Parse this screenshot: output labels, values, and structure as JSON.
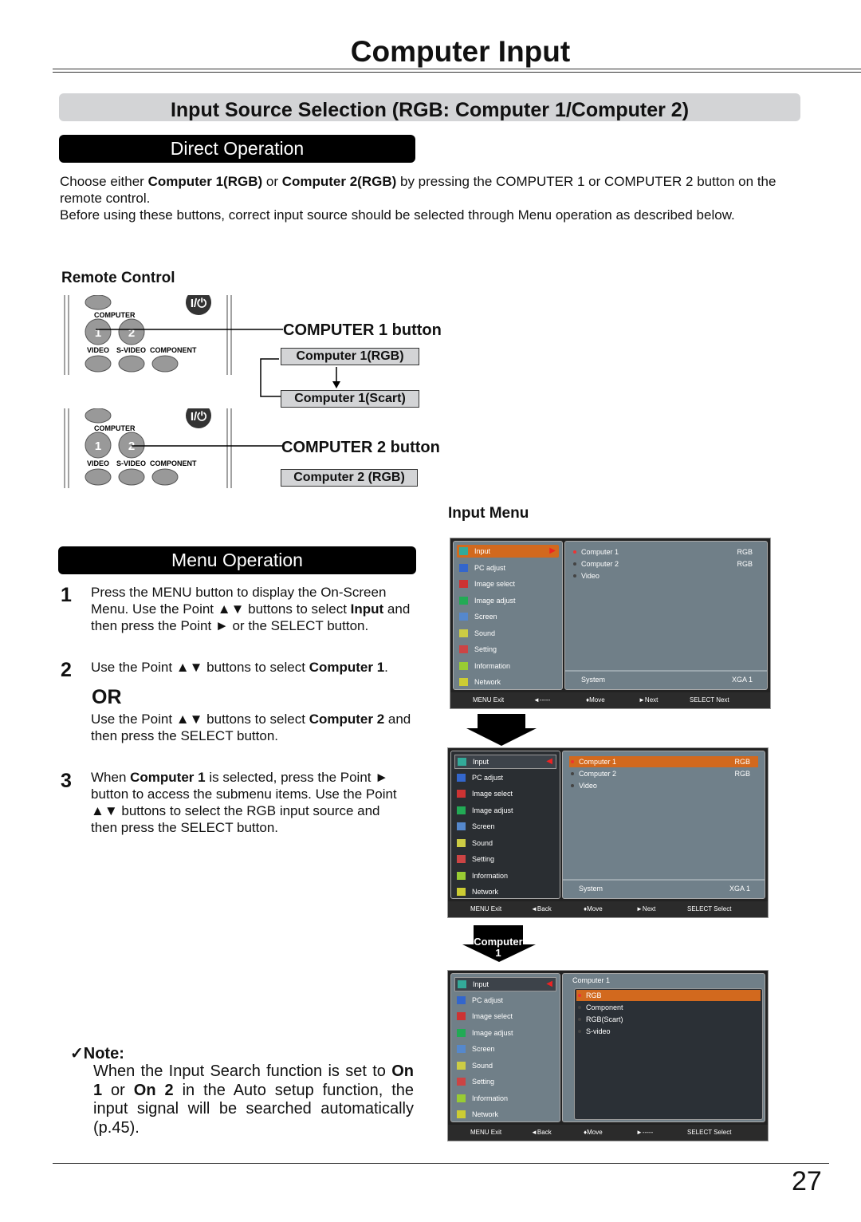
{
  "page": {
    "title": "Computer Input",
    "section_title": "Input Source Selection (RGB: Computer 1/Computer 2)",
    "page_number": "27"
  },
  "direct": {
    "heading": "Direct Operation",
    "p1_a": "Choose either ",
    "p1_b": "Computer 1(RGB)",
    "p1_c": " or ",
    "p1_d": "Computer 2(RGB)",
    "p1_e": " by pressing the COMPUTER 1 or COMPUTER 2 button on the remote control.",
    "p2": "Before using these buttons, correct input source should be selected through Menu operation as described below."
  },
  "remote": {
    "heading": "Remote Control",
    "labels": {
      "computer": "COMPUTER",
      "video": "VIDEO",
      "svideo": "S-VIDEO",
      "component": "COMPONENT",
      "power": "I/⏻",
      "b1": "1",
      "b2": "2"
    },
    "callout1": "COMPUTER 1 button",
    "box1a": "Computer 1(RGB)",
    "box1b": "Computer 1(Scart)",
    "callout2": "COMPUTER 2 button",
    "box2": "Computer 2 (RGB)"
  },
  "menu_op": {
    "heading": "Menu Operation",
    "s1_n": "1",
    "s1_a": "Press the MENU button to display the On-Screen Menu. Use the Point ▲▼ buttons to select ",
    "s1_b": "Input",
    "s1_c": " and then press the Point ► or the SELECT button.",
    "s2_n": "2",
    "s2_a": "Use the Point ▲▼ buttons to select ",
    "s2_b": "Computer 1",
    "s2_c": ".",
    "or": "OR",
    "s2b_a": "Use the Point ▲▼ buttons to select ",
    "s2b_b": "Computer 2",
    "s2b_c": " and then press the SELECT button.",
    "s3_n": "3",
    "s3_a": "When ",
    "s3_b": "Computer 1",
    "s3_c": " is selected, press the Point ► button to access the submenu items. Use the Point ▲▼ buttons to select the RGB input source and then press the SELECT button."
  },
  "note": {
    "heading": "✓Note:",
    "a": "When the Input Search function is set to ",
    "b": "On 1",
    "c": " or ",
    "d": "On 2",
    "e": " in the Auto setup function, the input signal will be searched automatically (p.45)."
  },
  "input_menu": {
    "heading": "Input Menu",
    "arrow2_label": "Computer 1",
    "left_items": [
      {
        "label": "Input",
        "icon": "input-icon"
      },
      {
        "label": "PC adjust",
        "icon": "pc-adjust-icon"
      },
      {
        "label": "Image select",
        "icon": "image-select-icon"
      },
      {
        "label": "Image adjust",
        "icon": "image-adjust-icon"
      },
      {
        "label": "Screen",
        "icon": "screen-icon"
      },
      {
        "label": "Sound",
        "icon": "sound-icon"
      },
      {
        "label": "Setting",
        "icon": "setting-icon"
      },
      {
        "label": "Information",
        "icon": "information-icon"
      },
      {
        "label": "Network",
        "icon": "network-icon"
      }
    ],
    "menus": [
      {
        "right": [
          {
            "label": "Computer 1",
            "value": "RGB"
          },
          {
            "label": "Computer 2",
            "value": "RGB"
          },
          {
            "label": "Video",
            "value": ""
          }
        ],
        "selected_right": -1,
        "system": "System",
        "system_value": "XGA 1",
        "footer": [
          "MENU Exit",
          "◄-----",
          "♦Move",
          "►Next",
          "SELECT Next"
        ]
      },
      {
        "right": [
          {
            "label": "Computer 1",
            "value": "RGB"
          },
          {
            "label": "Computer 2",
            "value": "RGB"
          },
          {
            "label": "Video",
            "value": ""
          }
        ],
        "selected_right": 0,
        "system": "System",
        "system_value": "XGA 1",
        "footer": [
          "MENU Exit",
          "◄Back",
          "♦Move",
          "►Next",
          "SELECT Select"
        ]
      },
      {
        "sub_title": "Computer 1",
        "right": [
          {
            "label": "RGB",
            "value": ""
          },
          {
            "label": "Component",
            "value": ""
          },
          {
            "label": "RGB(Scart)",
            "value": ""
          },
          {
            "label": "S-video",
            "value": ""
          }
        ],
        "selected_right": 0,
        "footer": [
          "MENU Exit",
          "◄Back",
          "♦Move",
          "►-----",
          "SELECT Select"
        ]
      }
    ]
  },
  "colors": {
    "highlight": "#d2691e",
    "menu_gray": "#707f88",
    "menu_dark": "#2a2e32",
    "section_bar": "#d3d4d6"
  }
}
